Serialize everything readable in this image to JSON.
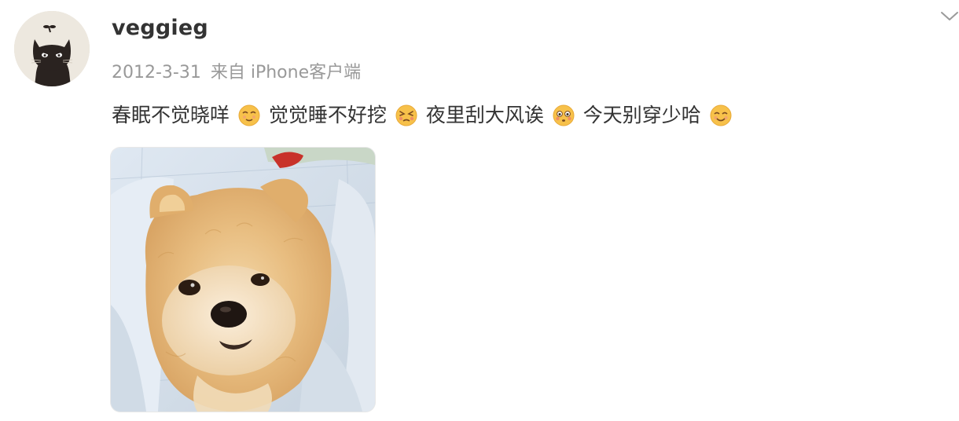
{
  "post": {
    "username": "veggieg",
    "date": "2012-3-31",
    "source": "来自 iPhone客户端",
    "content_segments": [
      {
        "type": "text",
        "value": "春眠不觉晓咩"
      },
      {
        "type": "emoji",
        "icon": "dizzy-face-emoji"
      },
      {
        "type": "text",
        "value": " 觉觉睡不好挖"
      },
      {
        "type": "emoji",
        "icon": "persevering-face-emoji"
      },
      {
        "type": "text",
        "value": "夜里刮大风诶"
      },
      {
        "type": "emoji",
        "icon": "flushed-face-emoji"
      },
      {
        "type": "text",
        "value": "今天别穿少哈"
      },
      {
        "type": "emoji",
        "icon": "relieved-face-emoji"
      }
    ],
    "image": {
      "icon": "pomeranian-dog-photo"
    }
  },
  "colors": {
    "username": "#333333",
    "meta": "#999999",
    "text": "#333333",
    "emoji_face": "#f7c14a"
  }
}
